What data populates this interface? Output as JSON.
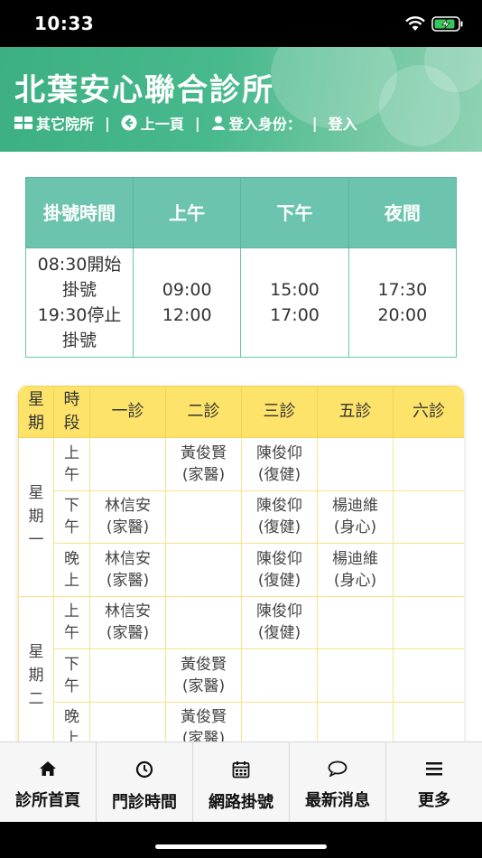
{
  "status_bar": {
    "time": "10:33"
  },
  "header": {
    "title": "北葉安心聯合診所",
    "nav": [
      {
        "label": "其它院所",
        "icon": "grid-icon"
      },
      {
        "label": "上一頁",
        "icon": "back-arrow-circle-icon"
      },
      {
        "label": "登入身份：",
        "icon": "user-icon"
      },
      {
        "label": "登入",
        "icon": ""
      }
    ],
    "separator": "|"
  },
  "info_table": {
    "headers": [
      "掛號時間",
      "上午",
      "下午",
      "夜間"
    ],
    "registration_lines": [
      "08:30開始",
      "掛號",
      "19:30停止",
      "掛號"
    ],
    "morning": [
      "09:00",
      "12:00"
    ],
    "afternoon": [
      "15:00",
      "17:00"
    ],
    "night": [
      "17:30",
      "20:00"
    ]
  },
  "schedule": {
    "headers": [
      "星期",
      "時段",
      "一診",
      "二診",
      "三診",
      "五診",
      "六診"
    ],
    "days": [
      {
        "day": "星期一",
        "slots": [
          {
            "period": "上午",
            "cells": [
              null,
              [
                "黃俊賢",
                "(家醫)"
              ],
              [
                "陳俊仰",
                "(復健)"
              ],
              null,
              null
            ]
          },
          {
            "period": "下午",
            "cells": [
              [
                "林信安",
                "(家醫)"
              ],
              null,
              [
                "陳俊仰",
                "(復健)"
              ],
              [
                "楊迪維",
                "(身心)"
              ],
              null
            ]
          },
          {
            "period": "晚上",
            "cells": [
              [
                "林信安",
                "(家醫)"
              ],
              null,
              [
                "陳俊仰",
                "(復健)"
              ],
              [
                "楊迪維",
                "(身心)"
              ],
              null
            ]
          }
        ]
      },
      {
        "day": "星期二",
        "slots": [
          {
            "period": "上午",
            "cells": [
              [
                "林信安",
                "(家醫)"
              ],
              null,
              [
                "陳俊仰",
                "(復健)"
              ],
              null,
              null
            ]
          },
          {
            "period": "下午",
            "cells": [
              null,
              [
                "黃俊賢",
                "(家醫)"
              ],
              null,
              null,
              null
            ]
          },
          {
            "period": "晚上",
            "cells": [
              null,
              [
                "黃俊賢",
                "(家醫)"
              ],
              null,
              null,
              null
            ]
          }
        ]
      }
    ]
  },
  "tabbar": [
    {
      "label": "診所首頁",
      "icon": "home-icon"
    },
    {
      "label": "門診時間",
      "icon": "clock-icon"
    },
    {
      "label": "網路掛號",
      "icon": "calendar-icon"
    },
    {
      "label": "最新消息",
      "icon": "chat-bubble-icon"
    },
    {
      "label": "更多",
      "icon": "menu-icon"
    }
  ],
  "colors": {
    "header_green": "#47b98c",
    "info_header": "#6cc4ae",
    "schedule_header": "#fde36a"
  }
}
